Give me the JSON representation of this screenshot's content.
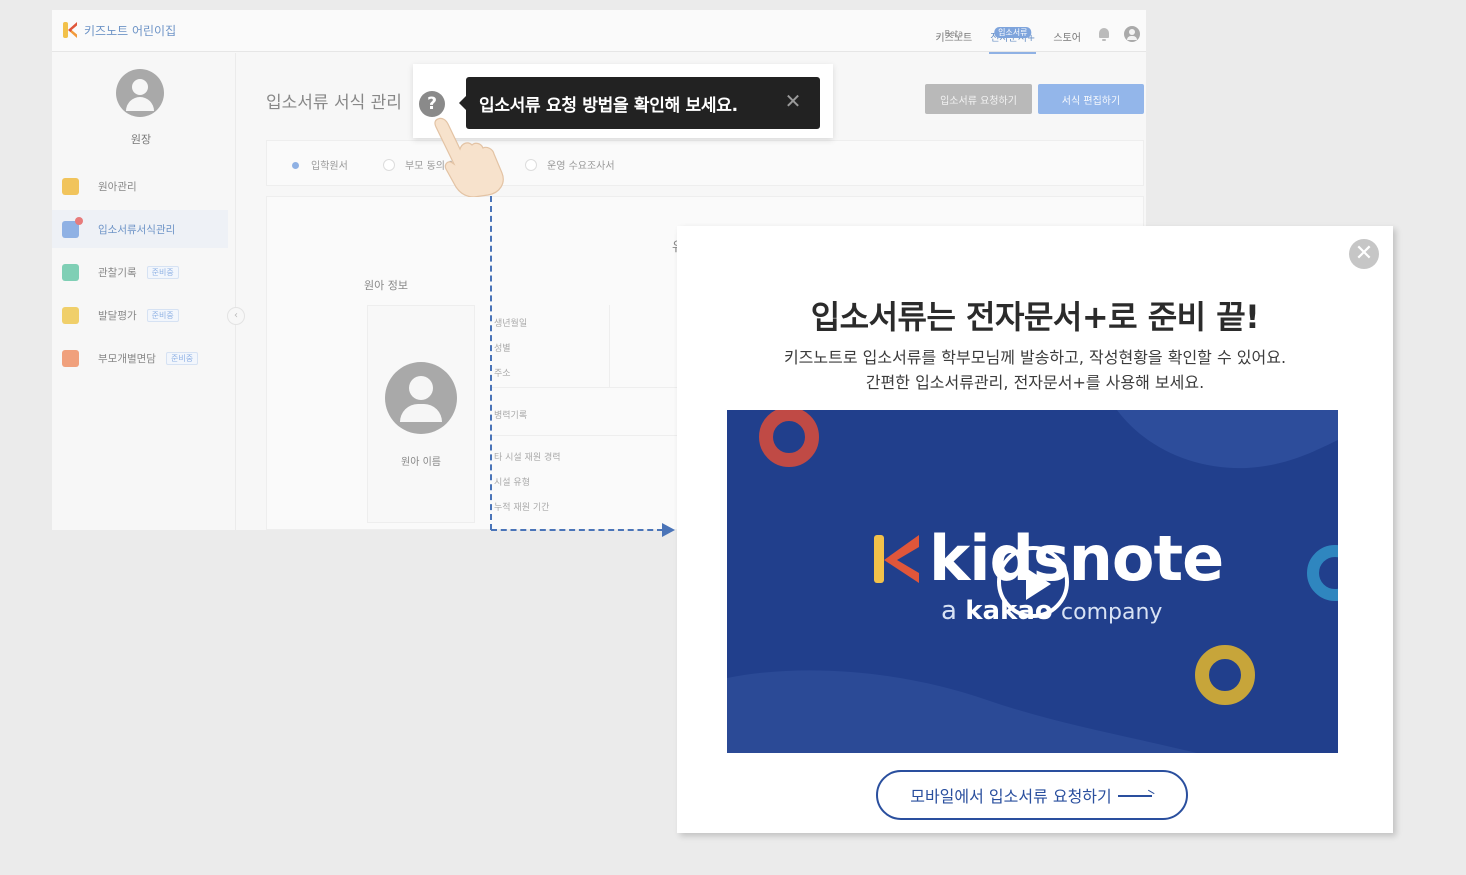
{
  "app": {
    "logo_text": "키즈노트 어린이집",
    "nav": [
      {
        "label": "키즈노트",
        "sup": "Beta"
      },
      {
        "label": "전자문서+",
        "sup": "입소서류"
      },
      {
        "label": "스토어",
        "sup": ""
      }
    ],
    "sidebar": {
      "role": "원장",
      "items": [
        {
          "label": "원아관리",
          "tag": ""
        },
        {
          "label": "입소서류서식관리",
          "tag": ""
        },
        {
          "label": "관찰기록",
          "tag": "준비중"
        },
        {
          "label": "발달평가",
          "tag": "준비중"
        },
        {
          "label": "부모개별면담",
          "tag": "준비중"
        }
      ],
      "collapse_glyph": "‹"
    },
    "page_title": "입소서류 서식 관리",
    "buttons": {
      "request": "입소서류 요청하기",
      "edit": "서식 편집하기"
    },
    "radios": [
      "입학원서",
      "부모 동의 동",
      "운영 수요조사서"
    ],
    "form": {
      "section_title": "원아 정보",
      "child_name": "원아 이름",
      "fields": [
        "생년월일",
        "성별",
        "주소",
        "병력기록",
        "타 시설 재원 경력",
        "시설 유형",
        "누적 재원 기간"
      ],
      "truncated_glyph": "유"
    }
  },
  "tooltip": {
    "help_glyph": "?",
    "text": "입소서류 요청 방법을 확인해 보세요.",
    "close_glyph": "✕"
  },
  "modal": {
    "close_glyph": "✕",
    "title": "입소서류는 전자문서+로 준비 끝!",
    "desc_line1": "키즈노트로 입소서류를 학부모님께 발송하고, 작성현황을 확인할 수 있어요.",
    "desc_line2": "간편한 입소서류관리, 전자문서+를 사용해 보세요.",
    "video": {
      "brand": "kidsnote",
      "tagline_a": "a",
      "tagline_kakao": "kakao",
      "tagline_company": "company"
    },
    "cta_label": "모바일에서 입소서류 요청하기"
  },
  "colors": {
    "accent": "#8fb1e4",
    "video_bg": "#213f8c",
    "cta": "#2a4f9e",
    "dash": "#4a74b8"
  }
}
